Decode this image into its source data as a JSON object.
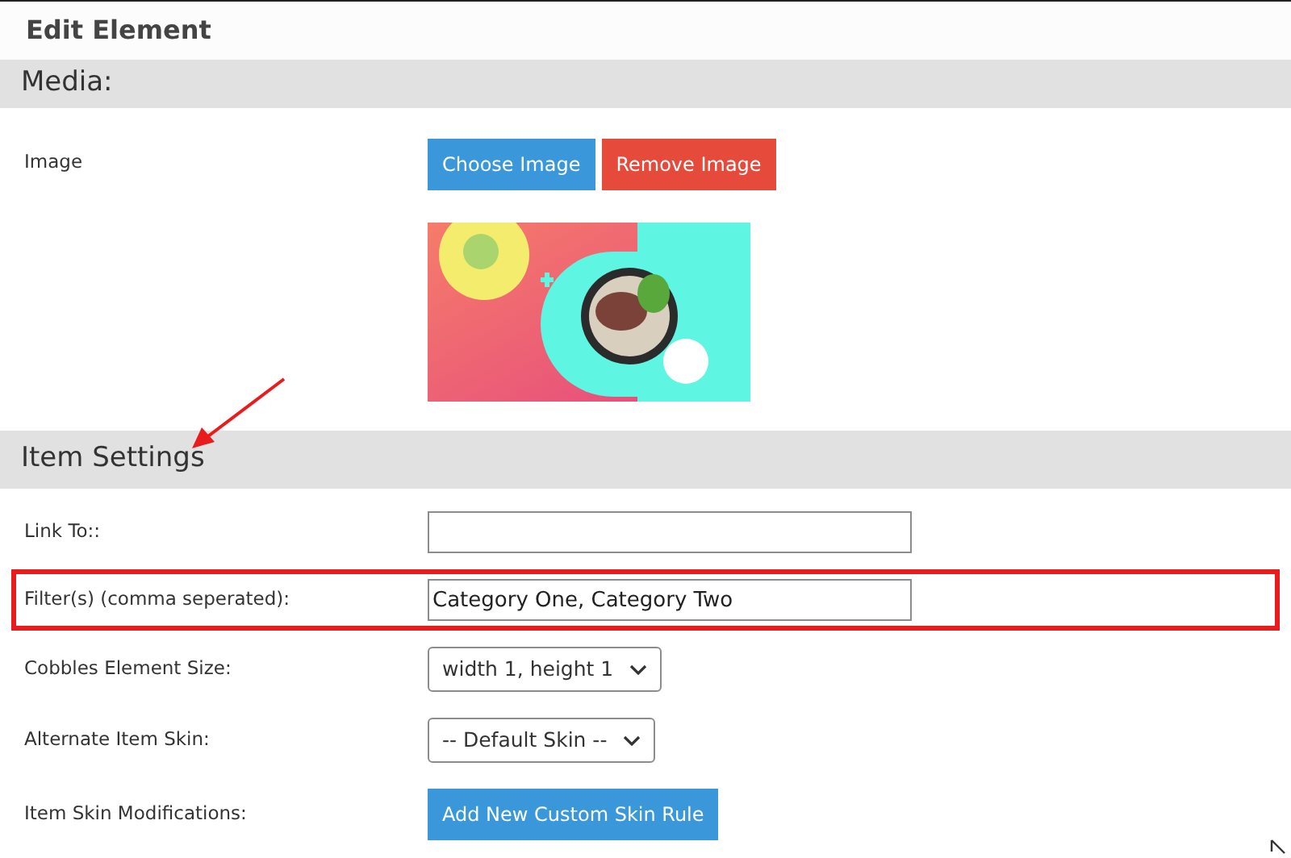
{
  "window": {
    "title": "Edit Element"
  },
  "sections": [
    {
      "title": "Media:",
      "rows": [
        {
          "kind": "buttons",
          "label": "Image",
          "buttons": [
            {
              "text": "Choose Image"
            },
            {
              "text": "Remove Image"
            }
          ]
        }
      ]
    },
    {
      "title": "Item Settings",
      "annotated": true,
      "rows": [
        {
          "kind": "input",
          "label": "Link To::",
          "value": "",
          "highlighted": false
        },
        {
          "kind": "input",
          "label": "Filter(s) (comma seperated):",
          "value": "Category One, Category Two",
          "highlighted": true
        },
        {
          "kind": "select",
          "label": "Cobbles Element Size:",
          "value": "width 1, height 1",
          "highlighted": false
        },
        {
          "kind": "select",
          "label": "Alternate Item Skin:",
          "value": "-- Default Skin --",
          "highlighted": false
        },
        {
          "kind": "button",
          "label": "Item Skin Modifications:",
          "buttons": [
            {
              "text": "Add New Custom Skin Rule"
            }
          ],
          "highlighted": false
        }
      ]
    }
  ]
}
